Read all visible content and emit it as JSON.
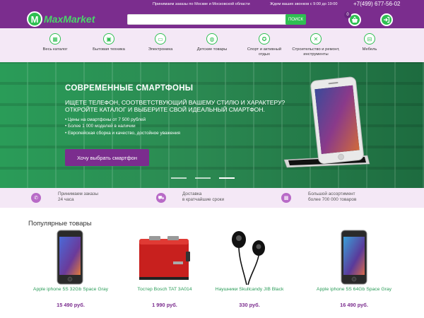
{
  "header": {
    "orders_info": "Принимаем заказы по Москве и Московской области",
    "calls_info": "Ждем ваших звонков с 9:00 до 19:00",
    "phone": "+7(499) 677-56-02",
    "logo_mark": "M",
    "logo_text": "MaxMarket",
    "search_placeholder": "",
    "search_button": "ПОИСК",
    "cart_count": "0"
  },
  "categories": [
    {
      "label": "Весь каталог",
      "icon": "catalog-icon",
      "glyph": "▦"
    },
    {
      "label": "Бытовая техника",
      "icon": "appliance-icon",
      "glyph": "▣"
    },
    {
      "label": "Электроника",
      "icon": "tv-icon",
      "glyph": "▭"
    },
    {
      "label": "Детские товары",
      "icon": "kids-icon",
      "glyph": "◍"
    },
    {
      "label": "Спорт и активный отдых",
      "icon": "ball-icon",
      "glyph": "✪"
    },
    {
      "label": "Строительство и ремонт, инструменты",
      "icon": "tools-icon",
      "glyph": "✕"
    },
    {
      "label": "Мебель",
      "icon": "furniture-icon",
      "glyph": "⊟"
    }
  ],
  "hero": {
    "title": "СОВРЕМЕННЫЕ СМАРТФОНЫ",
    "subtitle": "ИЩЕТЕ ТЕЛЕФОН, СООТВЕТСТВУЮЩИЙ ВАШЕМУ СТИЛЮ И ХАРАКТЕРУ? ОТКРОЙТЕ КАТАЛОГ И ВЫБЕРИТЕ СВОЙ ИДЕАЛЬНЫЙ СМАРТФОН.",
    "bullets": [
      "• Цены на смартфоны от 7 500 рублей",
      "• Более 1 000 моделей в наличии",
      "• Европейская сборка и качество, достойное уважения"
    ],
    "button": "Хочу выбрать смартфон",
    "active_slide": 3
  },
  "features": [
    {
      "line1": "Принимаем заказы",
      "line2": "24 часа",
      "icon": "phone-icon",
      "glyph": "✆"
    },
    {
      "line1": "Доставка",
      "line2": "в кратчайшие сроки",
      "icon": "truck-icon",
      "glyph": "⛟"
    },
    {
      "line1": "Большой ассортимент",
      "line2": "более 700 000 товаров",
      "icon": "gift-icon",
      "glyph": "▩"
    }
  ],
  "products_section": {
    "title": "Популярные товары",
    "items": [
      {
        "name": "Apple iphone 5S 32Gb Space Gray",
        "price": "15 490 руб."
      },
      {
        "name": "Тостер Bosch TAT 3A014",
        "price": "1 990 руб."
      },
      {
        "name": "Наушники Skullcandy JIB Black",
        "price": "330 руб."
      },
      {
        "name": "Apple iphone 5S 64Gb Space Gray",
        "price": "16 490 руб."
      }
    ]
  },
  "colors": {
    "brand_purple": "#7b2d8e",
    "brand_green": "#2fbf52",
    "nav_bg": "#f4e8f6"
  }
}
